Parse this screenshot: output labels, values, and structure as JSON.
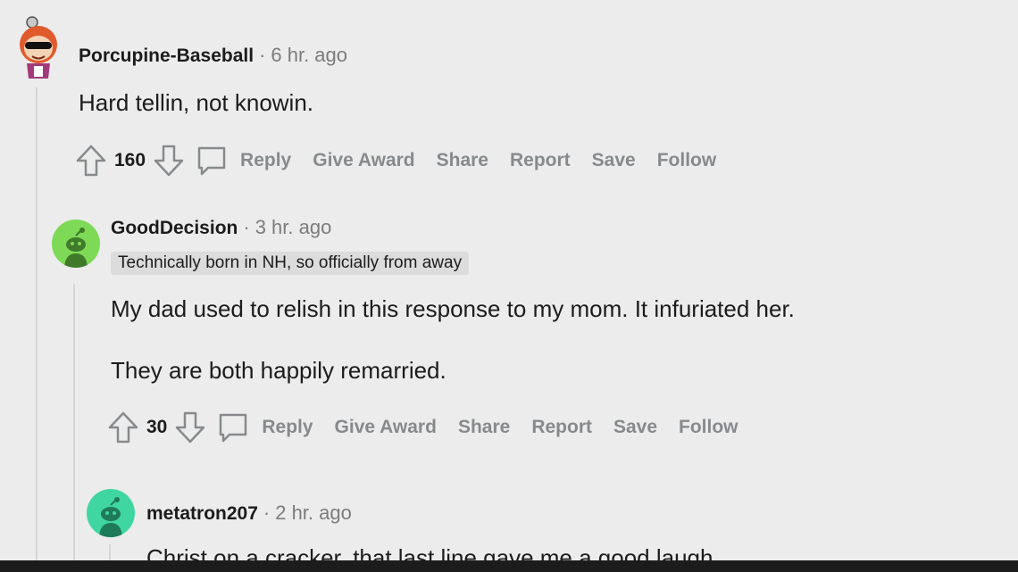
{
  "comments": [
    {
      "username": "Porcupine-Baseball",
      "time": "6 hr. ago",
      "body": [
        "Hard tellin, not knowin."
      ],
      "score": "160",
      "actions": {
        "reply": "Reply",
        "award": "Give Award",
        "share": "Share",
        "report": "Report",
        "save": "Save",
        "follow": "Follow"
      }
    },
    {
      "username": "GoodDecision",
      "time": "3 hr. ago",
      "flair": "Technically born in NH, so officially from away",
      "body": [
        "My dad used to relish in this response to my mom. It infuriated her.",
        "They are both happily remarried."
      ],
      "score": "30",
      "actions": {
        "reply": "Reply",
        "award": "Give Award",
        "share": "Share",
        "report": "Report",
        "save": "Save",
        "follow": "Follow"
      }
    },
    {
      "username": "metatron207",
      "time": "2 hr. ago",
      "body": [
        "Christ on a cracker, that last line gave me a good laugh."
      ]
    }
  ],
  "separator": "·",
  "colors": {
    "background": "#ececec",
    "action_text": "#878a8c",
    "avatar_green": "#7ed957",
    "avatar_teal": "#3fd6a2"
  }
}
